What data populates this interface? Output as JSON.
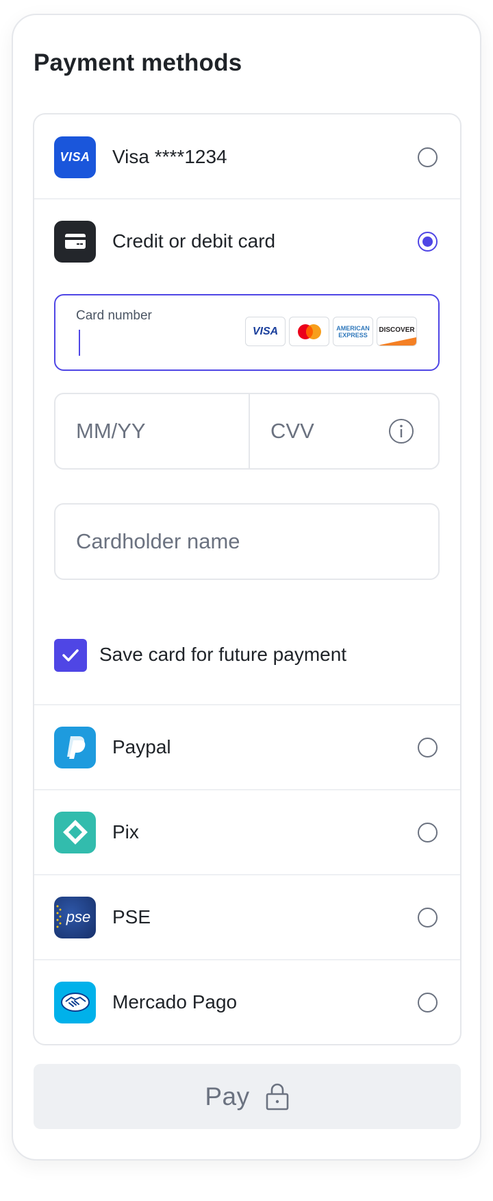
{
  "title": "Payment methods",
  "methods": {
    "saved_card": {
      "label": "Visa ****1234",
      "logo_text": "VISA",
      "selected": false
    },
    "credit_card": {
      "label": "Credit or debit card",
      "selected": true
    },
    "paypal": {
      "label": "Paypal",
      "selected": false
    },
    "pix": {
      "label": "Pix",
      "selected": false
    },
    "pse": {
      "label": "PSE",
      "logo_text": "pse",
      "selected": false
    },
    "mercado_pago": {
      "label": "Mercado Pago",
      "selected": false
    }
  },
  "card_form": {
    "card_number": {
      "label": "Card number",
      "value": ""
    },
    "brands": [
      {
        "name": "visa",
        "text": "VISA"
      },
      {
        "name": "mastercard",
        "text": ""
      },
      {
        "name": "amex",
        "text": "AMERICAN EXPRESS"
      },
      {
        "name": "discover",
        "text": "DISCOVER"
      }
    ],
    "expiry": {
      "placeholder": "MM/YY",
      "value": ""
    },
    "cvv": {
      "placeholder": "CVV",
      "value": ""
    },
    "cardholder": {
      "placeholder": "Cardholder name",
      "value": ""
    },
    "save_card": {
      "label": "Save card for future payment",
      "checked": true
    }
  },
  "pay_button": {
    "label": "Pay",
    "icon": "lock-icon"
  },
  "colors": {
    "accent": "#4f46e5",
    "visa_blue": "#1a56db",
    "card_icon_bg": "#23262b",
    "paypal_blue": "#1e9bde",
    "pix_teal": "#32bcad",
    "pse_navy": "#1b3a7a",
    "mercado_blue": "#00b1ea"
  }
}
